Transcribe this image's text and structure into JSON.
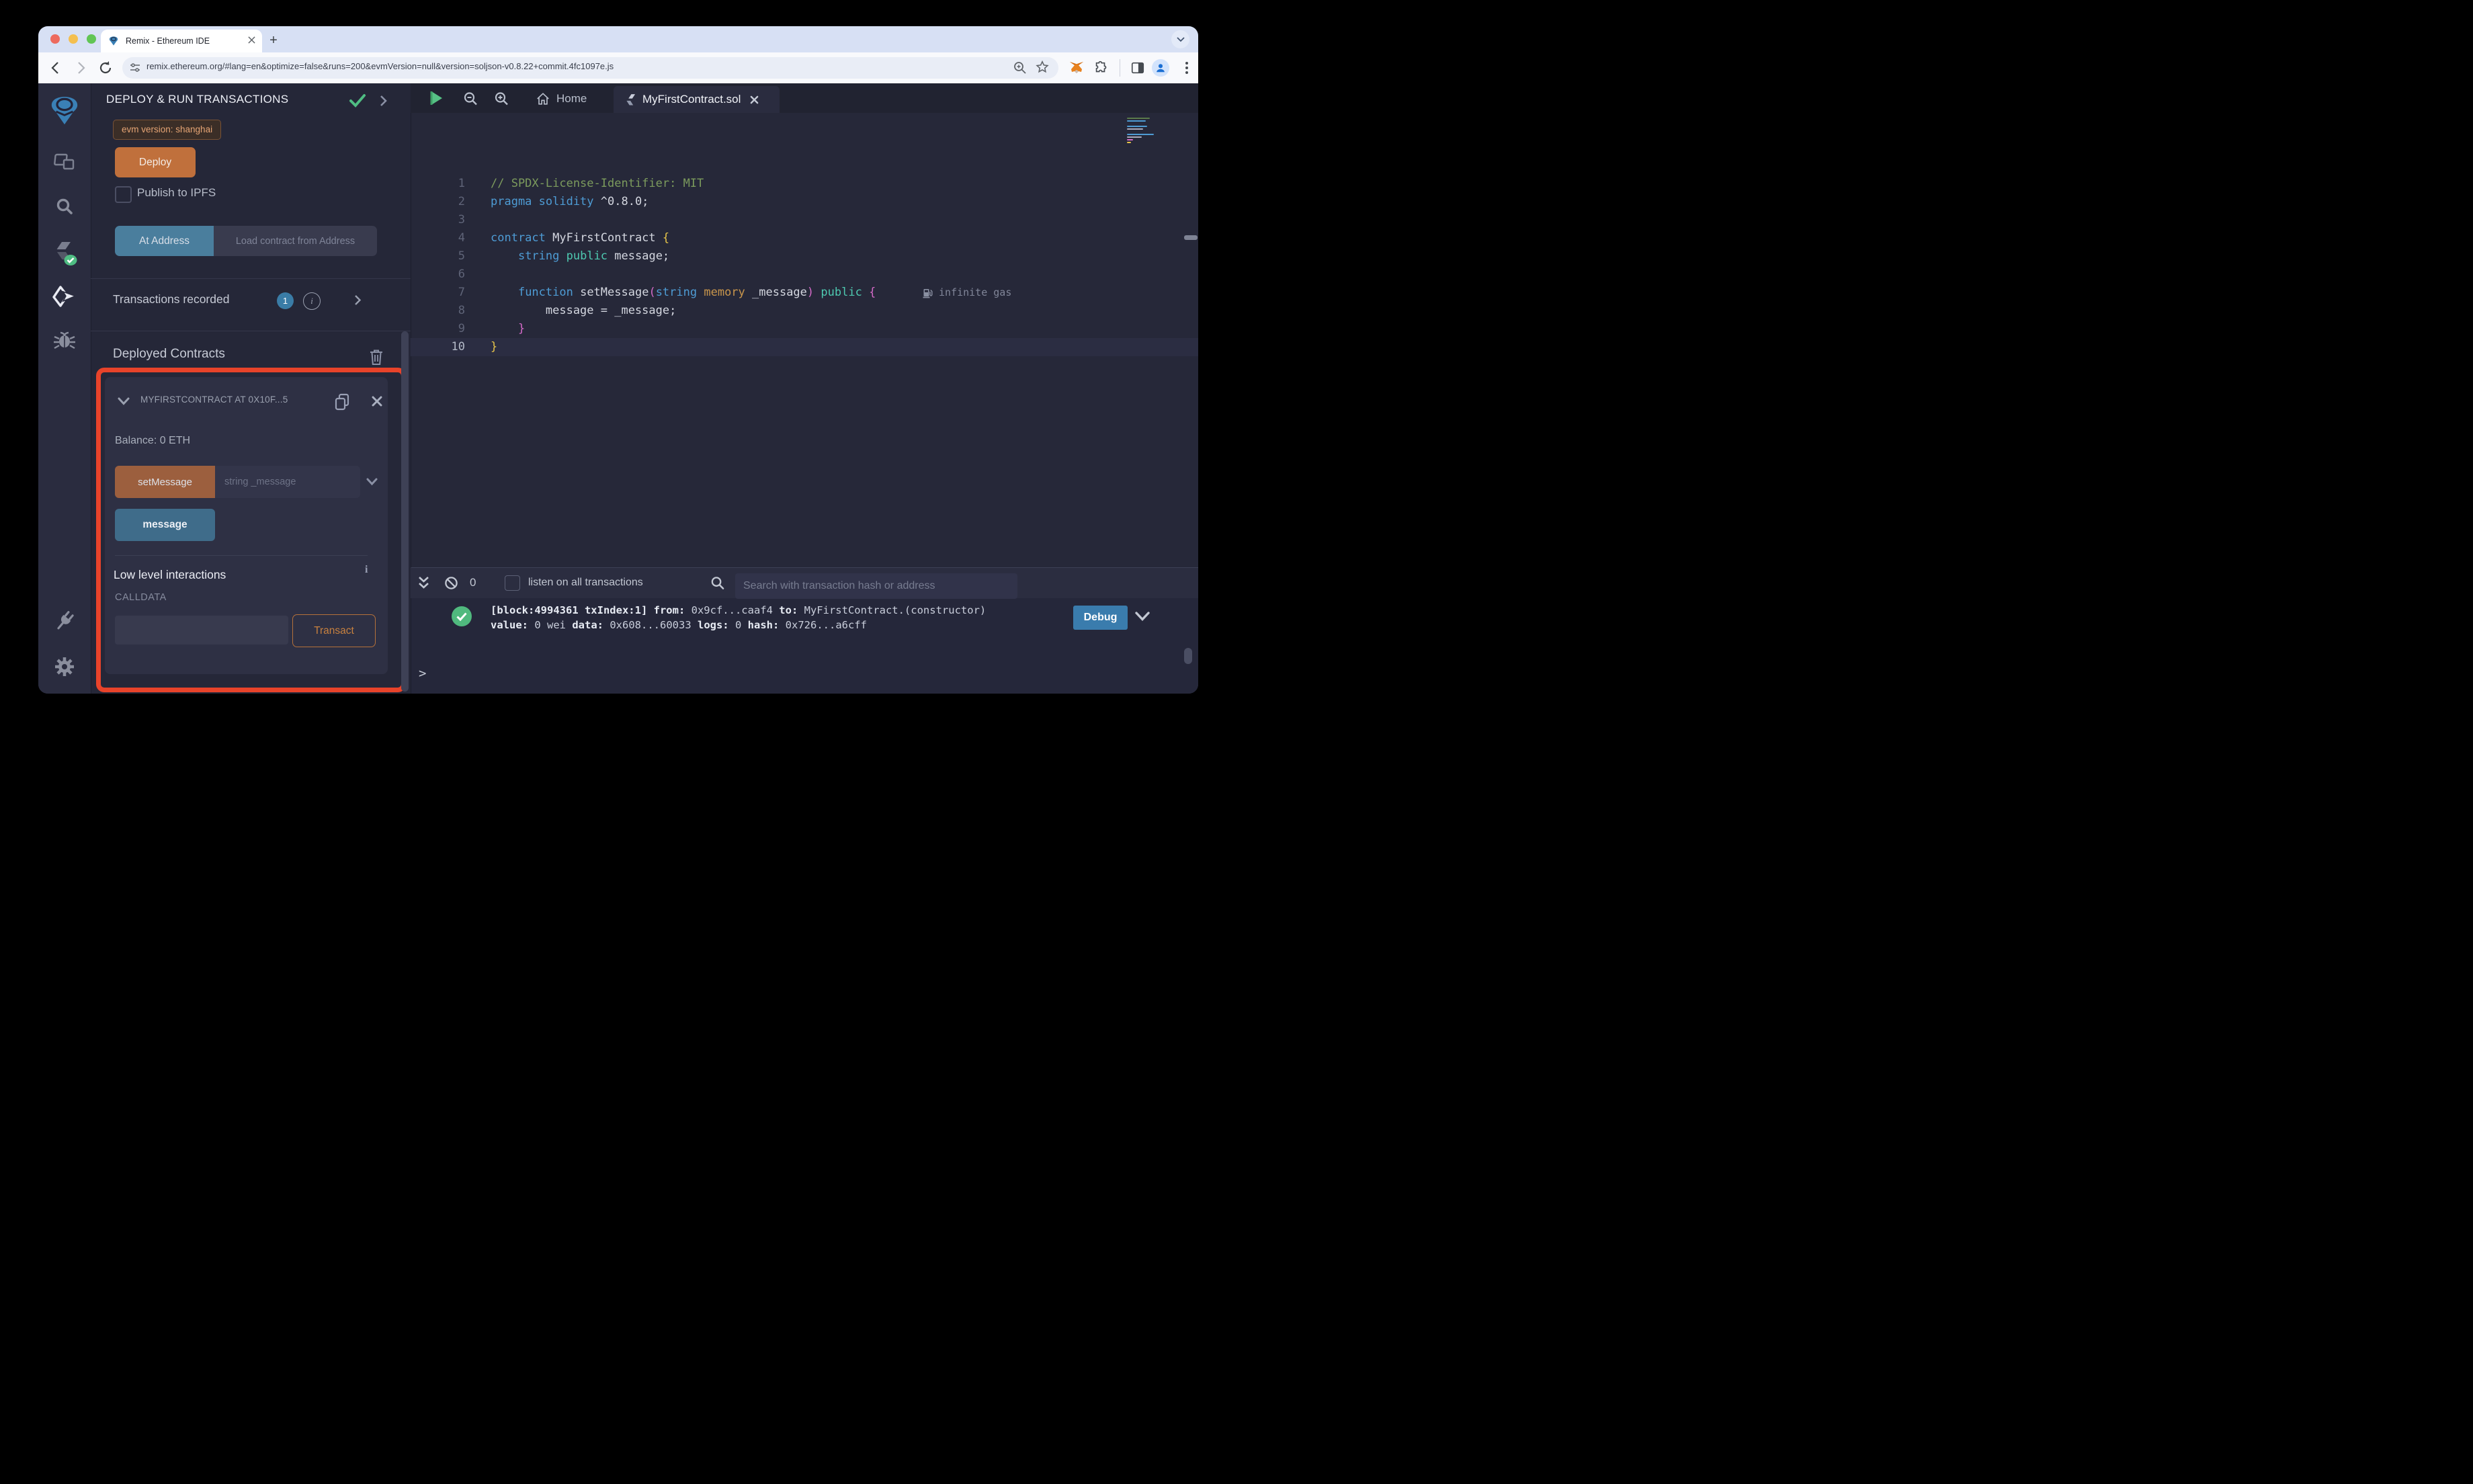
{
  "browser": {
    "tab_title": "Remix - Ethereum IDE",
    "url": "remix.ethereum.org/#lang=en&optimize=false&runs=200&evmVersion=null&version=soljson-v0.8.22+commit.4fc1097e.js"
  },
  "panel": {
    "title": "DEPLOY & RUN TRANSACTIONS",
    "evm_badge": "evm version: shanghai",
    "deploy_label": "Deploy",
    "publish_label": "Publish to IPFS",
    "at_address_label": "At Address",
    "load_contract_label": "Load contract from Address",
    "transactions_recorded_label": "Transactions recorded",
    "transactions_count": "1",
    "info_glyph": "i",
    "deployed_contracts_label": "Deployed Contracts",
    "contract": {
      "header": "MYFIRSTCONTRACT AT 0X10F...5",
      "balance": "Balance: 0 ETH",
      "set_message_label": "setMessage",
      "set_message_placeholder": "string _message",
      "message_label": "message",
      "low_level_label": "Low level interactions",
      "info_glyph": "i",
      "calldata_label": "CALLDATA",
      "calldata_value": "",
      "transact_label": "Transact"
    }
  },
  "editor": {
    "home_tab_label": "Home",
    "file_tab_label": "MyFirstContract.sol",
    "gas_annotation": "infinite gas",
    "code_lines": [
      {
        "n": "1",
        "tokens": [
          {
            "t": "// SPDX-License-Identifier: MIT",
            "c": "comment"
          }
        ]
      },
      {
        "n": "2",
        "tokens": [
          {
            "t": "pragma solidity ",
            "c": "kw"
          },
          {
            "t": "^0.8.0;",
            "c": "plain"
          }
        ]
      },
      {
        "n": "3",
        "tokens": []
      },
      {
        "n": "4",
        "tokens": [
          {
            "t": "contract ",
            "c": "kw"
          },
          {
            "t": "MyFirstContract ",
            "c": "plain"
          },
          {
            "t": "{",
            "c": "b1"
          }
        ]
      },
      {
        "n": "5",
        "tokens": [
          {
            "t": "    ",
            "c": "plain"
          },
          {
            "t": "string",
            "c": "kw"
          },
          {
            "t": " ",
            "c": "plain"
          },
          {
            "t": "public",
            "c": "kw2"
          },
          {
            "t": " message;",
            "c": "plain"
          }
        ]
      },
      {
        "n": "6",
        "tokens": []
      },
      {
        "n": "7",
        "tokens": [
          {
            "t": "    ",
            "c": "plain"
          },
          {
            "t": "function",
            "c": "kw"
          },
          {
            "t": " setMessage",
            "c": "plain"
          },
          {
            "t": "(",
            "c": "b2"
          },
          {
            "t": "string",
            "c": "kw"
          },
          {
            "t": " ",
            "c": "plain"
          },
          {
            "t": "memory",
            "c": "kw3"
          },
          {
            "t": " _message",
            "c": "plain"
          },
          {
            "t": ")",
            "c": "b2"
          },
          {
            "t": " ",
            "c": "plain"
          },
          {
            "t": "public",
            "c": "kw2"
          },
          {
            "t": " ",
            "c": "plain"
          },
          {
            "t": "{",
            "c": "b2"
          }
        ],
        "gas": true
      },
      {
        "n": "8",
        "tokens": [
          {
            "t": "        message = _message;",
            "c": "plain"
          }
        ]
      },
      {
        "n": "9",
        "tokens": [
          {
            "t": "    ",
            "c": "plain"
          },
          {
            "t": "}",
            "c": "b2"
          }
        ]
      },
      {
        "n": "10",
        "tokens": [
          {
            "t": "}",
            "c": "b1"
          }
        ],
        "active": true
      }
    ]
  },
  "terminal": {
    "badge_count": "0",
    "listen_label": "listen on all transactions",
    "search_placeholder": "Search with transaction hash or address",
    "log_lines": [
      [
        {
          "t": "[block:4994361 txIndex:1]  ",
          "b": 1
        },
        {
          "t": "from:",
          "b": 1
        },
        {
          "t": " 0x9cf...caaf4 ",
          "b": 0
        },
        {
          "t": "to:",
          "b": 1
        },
        {
          "t": " MyFirstContract.(constructor)",
          "b": 0
        }
      ],
      [
        {
          "t": "value:",
          "b": 1
        },
        {
          "t": " 0 wei ",
          "b": 0
        },
        {
          "t": "data:",
          "b": 1
        },
        {
          "t": " 0x608...60033 ",
          "b": 0
        },
        {
          "t": "logs:",
          "b": 1
        },
        {
          "t": " 0 ",
          "b": 0
        },
        {
          "t": "hash:",
          "b": 1
        },
        {
          "t": " 0x726...a6cff",
          "b": 0
        }
      ]
    ],
    "debug_label": "Debug",
    "prompt": ">"
  },
  "colors": {
    "accent_orange": "#c0703c",
    "highlight_red": "#e8432a",
    "teal_button": "#4a7e9d",
    "muted_orange_button": "#9c5f3e",
    "blue_button": "#3f6c8a",
    "debug_blue": "#3a7cad",
    "badge_blue": "#3a7ca6",
    "success_green": "#50b97e",
    "panel_bg": "#252738",
    "card_bg": "#2e3044",
    "editor_bg": "#262839"
  }
}
